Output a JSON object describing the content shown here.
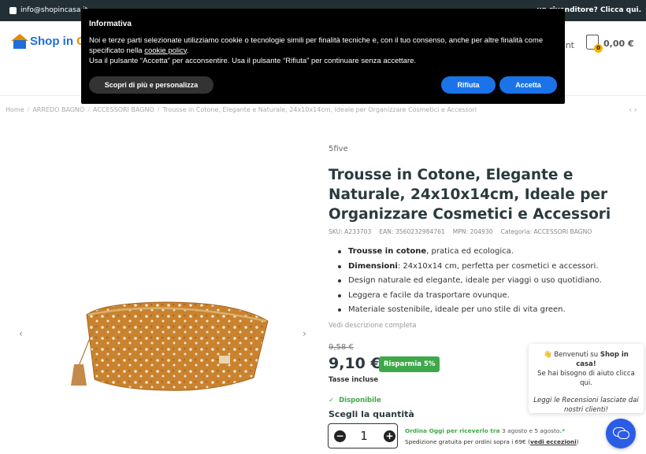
{
  "topbar": {
    "email": "info@shopincasa.it",
    "right_text": "un rivenditore? Clicca qui."
  },
  "header": {
    "logo_part1": "Shop in ",
    "logo_part2": "C",
    "account_label": "ount",
    "cart_count": "0",
    "cart_total": "0,00 €"
  },
  "breadcrumb": {
    "items": [
      "Home",
      "ARREDO BAGNO",
      "ACCESSORI BAGNO",
      "Trousse in Cotone, Elegante e Naturale, 24x10x14cm, Ideale per Organizzare Cosmetici e Accessori"
    ]
  },
  "product": {
    "brand": "5five",
    "title": "Trousse in Cotone, Elegante e Naturale, 24x10x14cm, Ideale per Organizzare Cosmetici e Accessori",
    "meta": {
      "sku": "SKU: A233703",
      "ean": "EAN: 3560232984761",
      "mpn": "MPN: 204930",
      "category": "Categoria: ACCESSORI BAGNO"
    },
    "bullets": [
      {
        "bold": "Trousse in cotone",
        "rest": ", pratica ed ecologica."
      },
      {
        "bold": "Dimensioni",
        "rest": ": 24x10x14 cm, perfetta per cosmetici e accessori."
      },
      {
        "bold": "",
        "rest": "Design naturale ed elegante, ideale per viaggi o uso quotidiano."
      },
      {
        "bold": "",
        "rest": "Leggera e facile da trasportare ovunque."
      },
      {
        "bold": "",
        "rest": "Materiale sostenibile, ideale per uno stile di vita green."
      }
    ],
    "desc_link": "Vedi descrizione completa",
    "old_price": "9,58 €",
    "price": "9,10 €",
    "save_badge": "Risparmia 5%",
    "tax_note": "Tasse incluse",
    "availability": "Disponibile",
    "qty_label": "Scegli la quantità",
    "qty_value": "1",
    "shipping_line1_a": "Ordina Oggi per riceverlo tra ",
    "shipping_line1_b": "3 agosto e 5 agosto",
    "shipping_line1_c": ".*",
    "shipping_line2_a": "Spedizione gratuita per ordini sopra i 69€ (",
    "shipping_line2_b": "vedi eccezioni",
    "shipping_line2_c": ")"
  },
  "chat": {
    "line1_a": "👋 Benvenuti su ",
    "line1_b": "Shop in casa!",
    "line2": "Se hai bisogno di aiuto clicca qui.",
    "line3": "Leggi le Recensioni lasciate dai nostri clienti!"
  },
  "cookie": {
    "title": "Informativa",
    "text1": "Noi e terze parti selezionate utilizziamo cookie o tecnologie simili per finalità tecniche e, con il tuo consenso, anche per altre finalità come specificato nella ",
    "policy_link": "cookie policy",
    "text1_end": ".",
    "text2": "Usa il pulsante “Accetta” per acconsentire. Usa il pulsante “Rifiuta” per continuare senza accettare.",
    "btn_more": "Scopri di più e personalizza",
    "btn_reject": "Rifiuta",
    "btn_accept": "Accetta"
  },
  "colors": {
    "topbar": "#223035",
    "brand_blue": "#1e6fd9",
    "brand_orange": "#e68a00",
    "green": "#3ea84a",
    "cookie_button": "#1a73e8",
    "product_fabric": "#c9822e"
  }
}
